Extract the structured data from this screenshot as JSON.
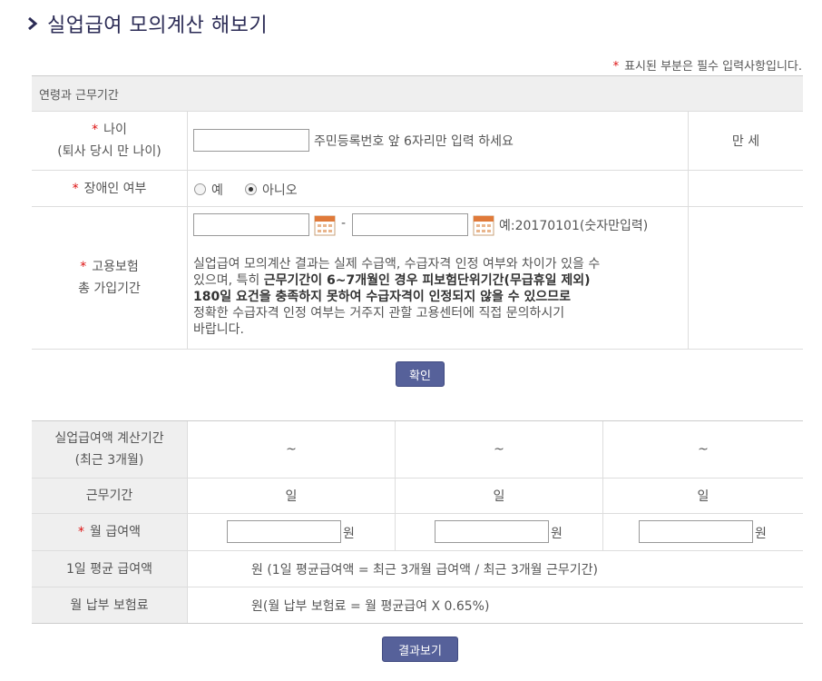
{
  "page": {
    "title": "실업급여 모의계산 해보기",
    "required_note": "표시된 부분은 필수 입력사항입니다.",
    "required_mark": "*"
  },
  "section": {
    "header": "연령과 근무기간"
  },
  "age": {
    "label_line1": "나이",
    "label_line2": "(퇴사 당시 만 나이)",
    "hint": "주민등록번호 앞 6자리만 입력 하세요",
    "unit": "만 세",
    "value": ""
  },
  "disability": {
    "label": "장애인 여부",
    "options": [
      {
        "label": "예",
        "checked": false
      },
      {
        "label": "아니오",
        "checked": true
      }
    ]
  },
  "insurance": {
    "label_line1": "고용보험",
    "label_line2": "총 가입기간",
    "dash": "-",
    "example": "예:20170101(숫자만입력)",
    "warn_1": "실업급여 모의계산 결과는 실제 수급액, 수급자격 인정 여부와 차이가 있을 수",
    "warn_2a": "있으며, 특히 ",
    "warn_2b": "근무기간이 6~7개월인 경우 피보험단위기간(무급휴일 제외)",
    "warn_3": "180일 요건을 충족하지 못하여 수급자격이 인정되지 않을 수 있으므로",
    "warn_4": "정확한 수급자격 인정 여부는 거주지 관할 고용센터에 직접 문의하시기",
    "warn_5": "바랍니다."
  },
  "confirm_button": "확인",
  "calc": {
    "period_label_1": "실업급여액 계산기간",
    "period_label_2": "(최근 3개월)",
    "period_values": [
      "~",
      "~",
      "~"
    ],
    "workdays_label": "근무기간",
    "workdays_unit": "일",
    "pay_label": "월 급여액",
    "pay_unit": "원",
    "daily_label": "1일 평균 급여액",
    "daily_text": "원 (1일 평균급여액 = 최근 3개월 급여액 / 최근 3개월 근무기간)",
    "premium_label": "월 납부 보험료",
    "premium_text": "원(월 납부 보험료 = 월 평균급여 X 0.65%)"
  },
  "result_button": "결과보기",
  "colors": {
    "button": "#56619a",
    "required": "#dd1111",
    "header_bg": "#efefef",
    "title": "#2b2b55"
  }
}
